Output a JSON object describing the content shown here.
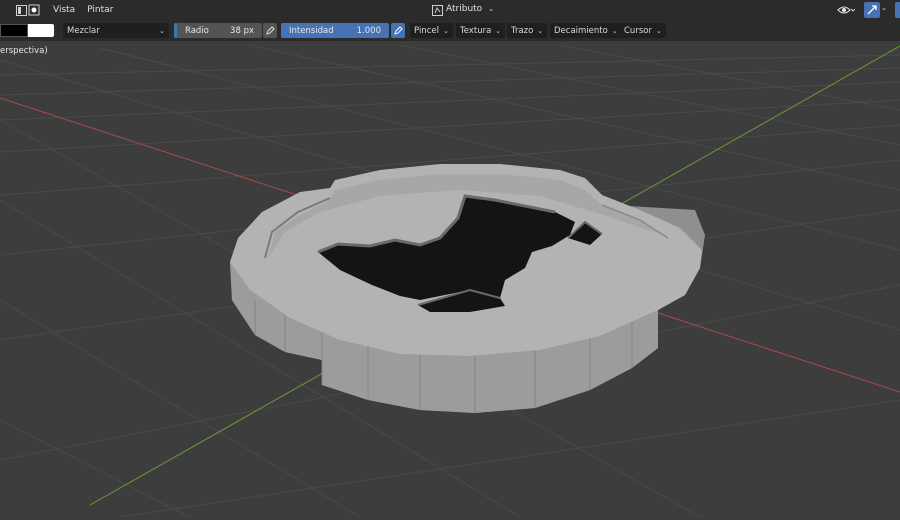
{
  "header": {
    "menus": [
      "Vista",
      "Pintar"
    ],
    "mode_dropdown": {
      "label": "Atributo",
      "icon": "vertex-paint-icon"
    },
    "right_icons": [
      "visibility-eye-icon",
      "gizmo-icon"
    ]
  },
  "toolbar": {
    "colors": {
      "primary": "#000000",
      "secondary": "#ffffff"
    },
    "blend_mode": "Mezclar",
    "radius": {
      "label": "Radio",
      "value": "38 px"
    },
    "strength": {
      "label": "Intensidad",
      "value": "1.000",
      "fill_fraction": 1.0
    },
    "panels": [
      "Pincel",
      "Textura",
      "Trazo",
      "Decaimiento",
      "Cursor"
    ]
  },
  "viewport": {
    "view_label": "erspectiva)",
    "background": "#3d3d3d",
    "grid_color": "#4a4a4a",
    "x_axis_color": "#a84a4a",
    "y_axis_color": "#6a9a35",
    "object_color": "#b3b3b3"
  },
  "colors": {
    "accent": "#4772b3",
    "header_bg": "#2b2b2b",
    "field_bg": "#1f1f1f"
  }
}
